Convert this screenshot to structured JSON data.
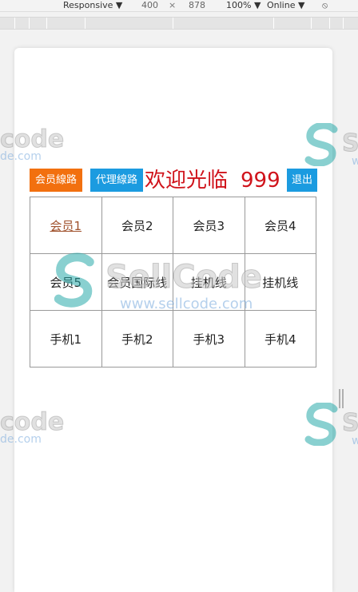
{
  "devtools": {
    "device": "Responsive ▼",
    "width": "400",
    "times": "×",
    "height": "878",
    "zoom": "100% ▼",
    "network": "Online ▼",
    "rotate_glyph": "⦸"
  },
  "header": {
    "member_lines_label": "会员線路",
    "agent_lines_label": "代理線路",
    "welcome_text": "欢迎光临",
    "user_number": "999",
    "logout_label": "退出"
  },
  "colors": {
    "member_button": "#f2700f",
    "agent_button": "#1b9be0",
    "logout_button": "#1b9be0",
    "welcome_red": "#d0131b",
    "link_brown": "#a0522d"
  },
  "grid": {
    "rows": [
      [
        "会员1",
        "会员2",
        "会员3",
        "会员4"
      ],
      [
        "会员5",
        "会员国际线",
        "挂机线",
        "挂机线"
      ],
      [
        "手机1",
        "手机2",
        "手机3",
        "手机4"
      ]
    ]
  },
  "watermark": {
    "brand": "SellCode",
    "brand_partial": "code",
    "brand_partial_right": "Se",
    "url": "www.sellcode.com",
    "url_partial": "de.com",
    "url_partial_right": "w"
  }
}
